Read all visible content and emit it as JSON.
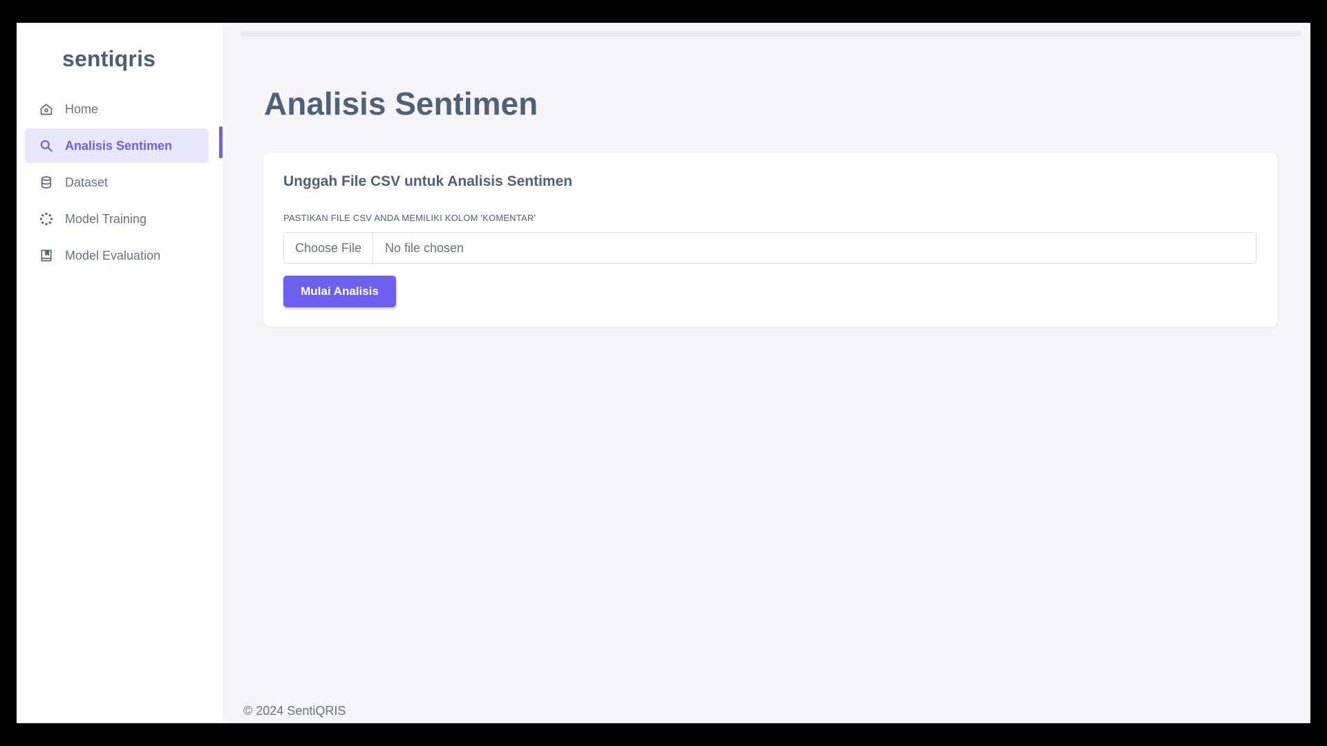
{
  "sidebar": {
    "brand": "sentiqris",
    "items": [
      {
        "label": "Home",
        "icon": "home-icon",
        "active": false
      },
      {
        "label": "Analisis Sentimen",
        "icon": "search-icon",
        "active": true
      },
      {
        "label": "Dataset",
        "icon": "database-icon",
        "active": false
      },
      {
        "label": "Model Training",
        "icon": "spinner-icon",
        "active": false
      },
      {
        "label": "Model Evaluation",
        "icon": "book-icon",
        "active": false
      }
    ]
  },
  "main": {
    "title": "Analisis Sentimen",
    "card": {
      "title": "Unggah File CSV untuk Analisis Sentimen",
      "hint": "PASTIKAN FILE CSV ANDA MEMILIKI KOLOM 'KOMENTAR'",
      "file_input": {
        "button_label": "Choose File",
        "status": "No file chosen"
      },
      "submit_label": "Mulai Analisis"
    }
  },
  "footer": {
    "text": "© 2024 SentiQRIS"
  },
  "colors": {
    "accent": "#6d5ff0",
    "active_bg": "#e8e6fb",
    "text_primary": "#4f6079",
    "text_muted": "#6b7280",
    "page_bg": "#f4f4f9"
  }
}
